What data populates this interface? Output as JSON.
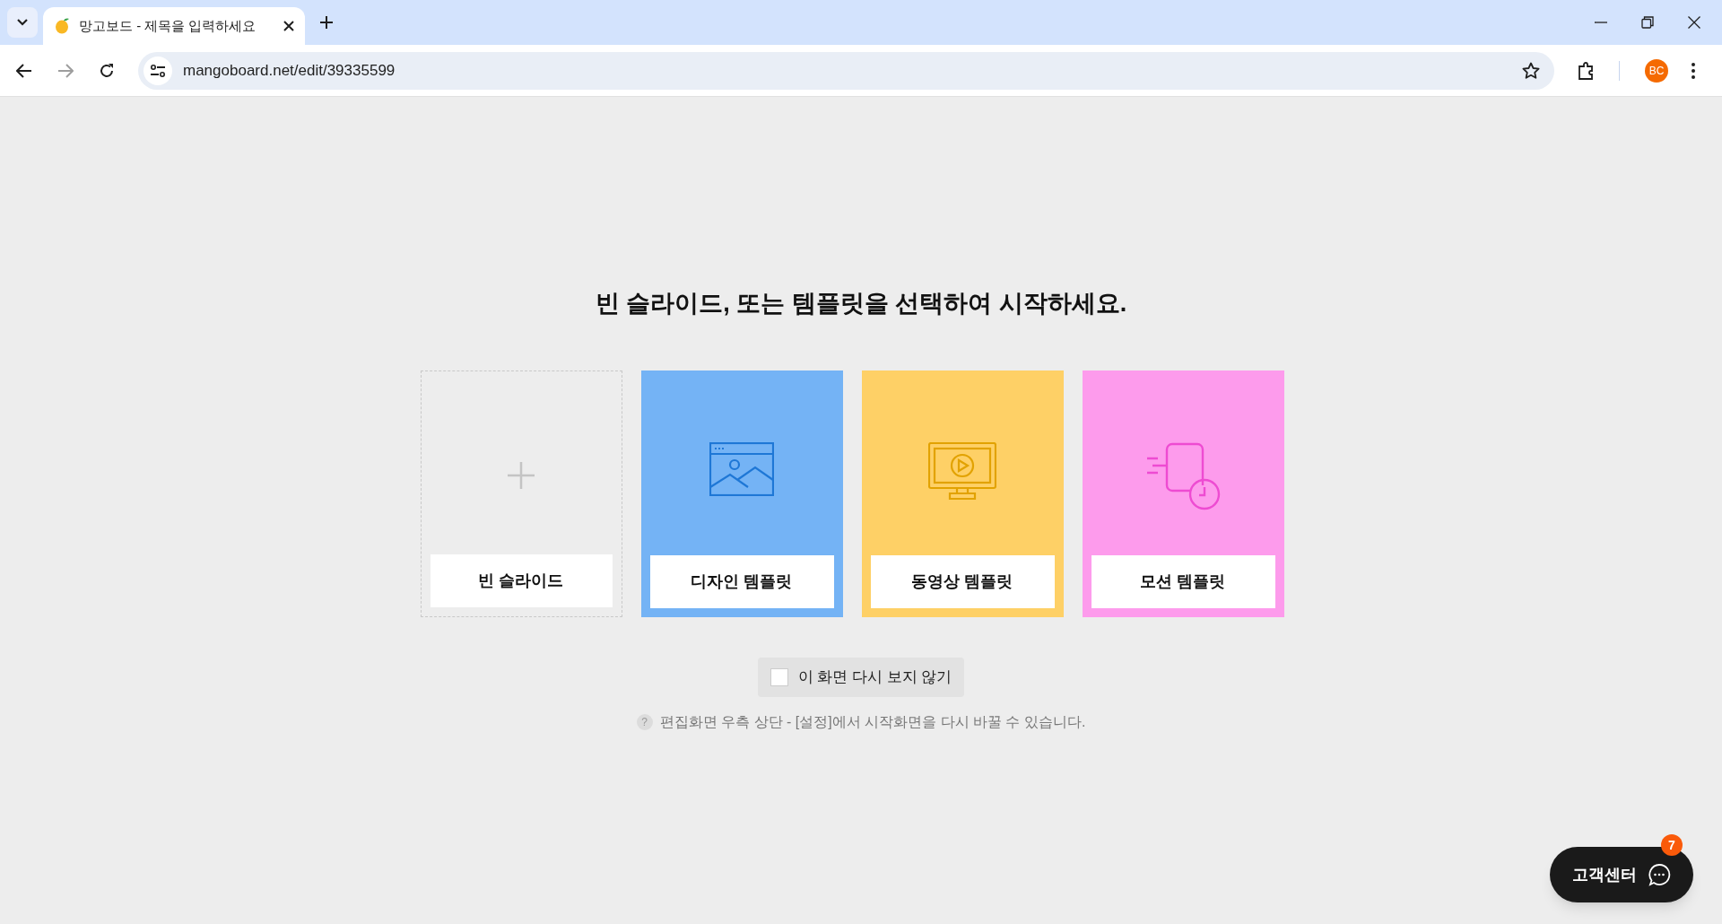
{
  "browser": {
    "tab_title": "망고보드 - 제목을 입력하세요",
    "url": "mangoboard.net/edit/39335599",
    "profile_initials": "BC"
  },
  "heading": "빈 슬라이드, 또는 템플릿을 선택하여 시작하세요.",
  "cards": [
    {
      "kind": "blank",
      "label": "빈 슬라이드"
    },
    {
      "kind": "design",
      "label": "디자인 템플릿",
      "color": "#74b3f5"
    },
    {
      "kind": "video",
      "label": "동영상 템플릿",
      "color": "#fed066"
    },
    {
      "kind": "motion",
      "label": "모션 템플릿",
      "color": "#fd9bec"
    }
  ],
  "dont_show_again": {
    "label": "이 화면 다시 보지 않기",
    "checked": false
  },
  "hint": {
    "icon": "?",
    "text": "편집화면 우측 상단 - [설정]에서 시작화면을 다시 바꿀 수 있습니다."
  },
  "support_button": {
    "label": "고객센터",
    "badge": "7"
  }
}
